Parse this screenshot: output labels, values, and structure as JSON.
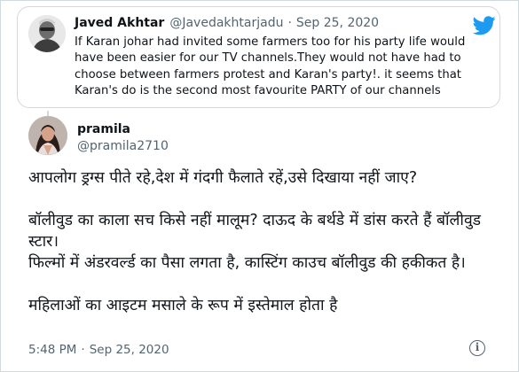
{
  "quoted_tweet": {
    "name": "Javed Akhtar",
    "handle": "@Javedakhtarjadu",
    "separator": "·",
    "date": "Sep 25, 2020",
    "text": "If Karan johar had invited some farmers too for his party life would have been easier for our TV channels.They would not have had to choose between farmers protest and Karan's party!. it seems that Karan's do is the second most favourite PARTY of  our channels",
    "bird_icon": "twitter-bird-icon",
    "brand_color": "#1d9bf0"
  },
  "tweet": {
    "name": "pramila",
    "handle": "@pramila2710",
    "lines": [
      "आपलोग ड्रग्स पीते रहे,देश में गंदगी फैलाते रहें,उसे दिखाया नहीं जाए?",
      "",
      "बॉलीवुड का काला सच किसे नहीं मालूम? दाऊद के बर्थडे में डांस करते हैं बॉलीवुड स्टार।",
      "फिल्मों में अंडरवर्ल्ड का पैसा लगता है, कास्टिंग काउच बॉलीवुड की हकीकत है।",
      "",
      "महिलाओं का आइटम मसाले के रूप में इस्तेमाल होता है"
    ],
    "time": "5:48 PM",
    "separator": "·",
    "date": "Sep 25, 2020",
    "info_icon": "i"
  }
}
